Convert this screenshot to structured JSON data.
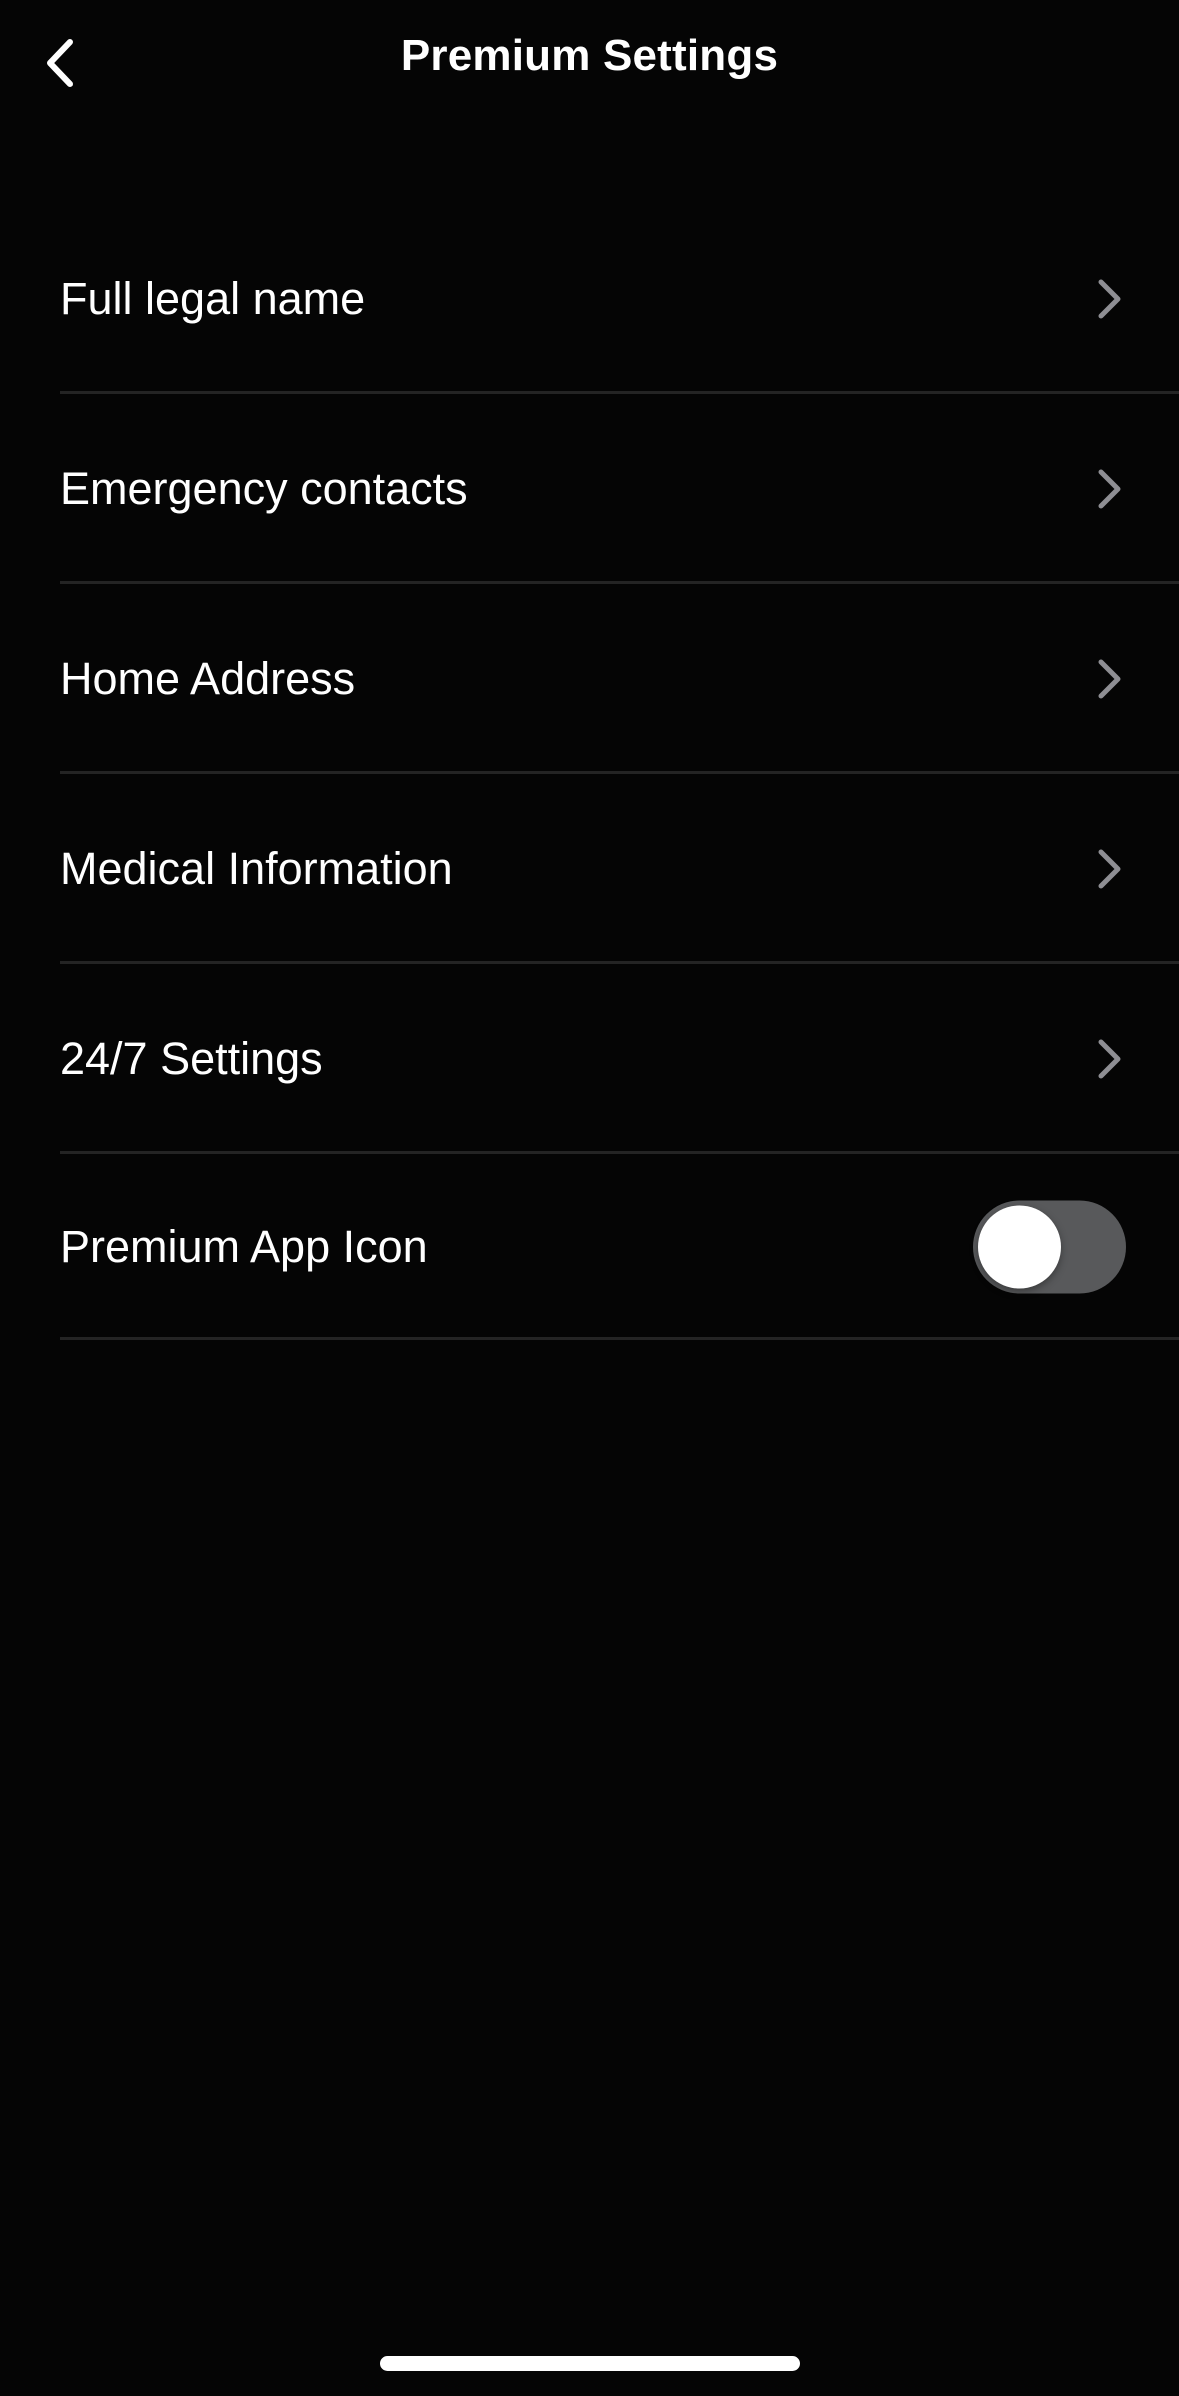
{
  "header": {
    "title": "Premium Settings",
    "back_icon": "chevron-left-icon"
  },
  "settings": {
    "items": [
      {
        "label": "Full legal name",
        "accessory": "chevron-right-icon"
      },
      {
        "label": "Emergency contacts",
        "accessory": "chevron-right-icon"
      },
      {
        "label": "Home Address",
        "accessory": "chevron-right-icon"
      },
      {
        "label": "Medical Information",
        "accessory": "chevron-right-icon"
      },
      {
        "label": "24/7 Settings",
        "accessory": "chevron-right-icon"
      }
    ],
    "toggle_item": {
      "label": "Premium App Icon",
      "enabled": false
    }
  },
  "colors": {
    "background": "#050505",
    "text": "#ffffff",
    "chevron": "#8e8e93",
    "divider": "#242424",
    "toggle_off_track": "#58595b",
    "toggle_knob": "#ffffff"
  }
}
